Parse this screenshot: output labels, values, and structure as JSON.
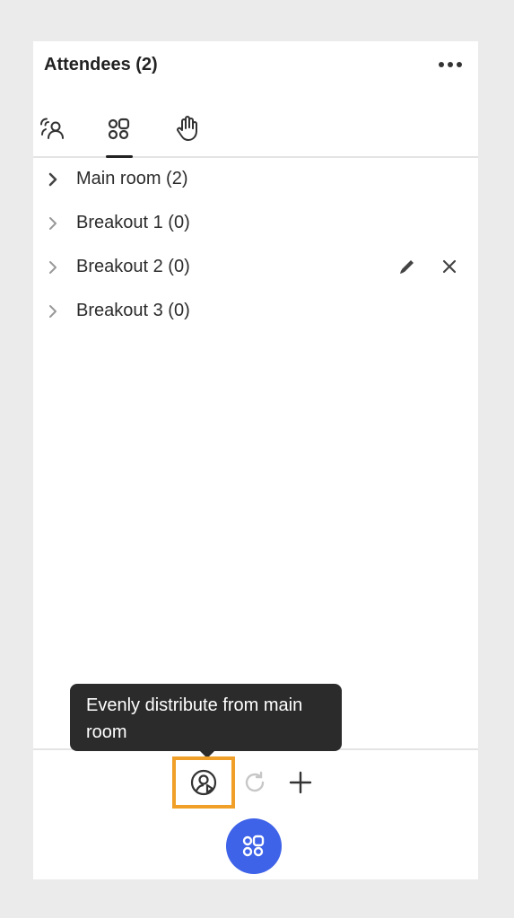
{
  "header": {
    "title": "Attendees (2)",
    "more_icon": "more-horizontal-icon"
  },
  "tabs": [
    {
      "name": "attendees",
      "icon": "people-icon",
      "active": false
    },
    {
      "name": "breakout-rooms",
      "icon": "breakout-rooms-icon",
      "active": true
    },
    {
      "name": "raised-hands",
      "icon": "hand-icon",
      "active": false
    }
  ],
  "rooms": [
    {
      "label": "Main room (2)",
      "chevron_emphasis": true
    },
    {
      "label": "Breakout 1 (0)",
      "chevron_emphasis": false
    },
    {
      "label": "Breakout 2 (0)",
      "chevron_emphasis": false,
      "actions": [
        "edit-icon",
        "close-icon"
      ]
    },
    {
      "label": "Breakout 3 (0)",
      "chevron_emphasis": false
    }
  ],
  "tooltip": {
    "text": "Evenly distribute from main room"
  },
  "toolbar": {
    "distribute_icon": "distribute-user-icon",
    "refresh_icon": "refresh-icon",
    "add_icon": "plus-icon"
  },
  "fab": {
    "icon": "breakout-rooms-icon",
    "color": "#3e62e8"
  },
  "colors": {
    "highlight": "#f0a028",
    "accent": "#3e62e8"
  }
}
